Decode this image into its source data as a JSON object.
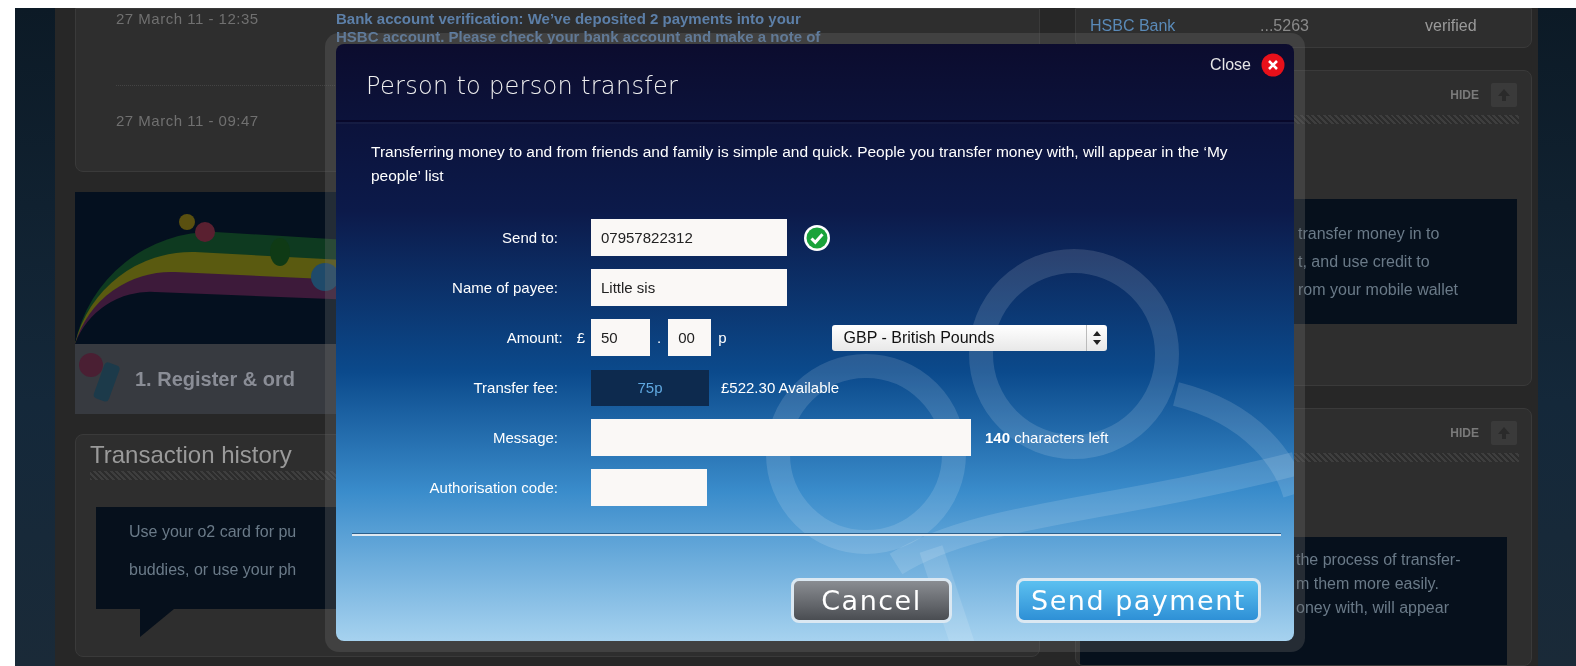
{
  "background": {
    "notifications": [
      {
        "time": "27 March 11 - 12:35",
        "lines": [
          "Bank account verification: We’ve deposited 2 payments into your",
          "HSBC account. Please check your bank account and make a note of"
        ]
      },
      {
        "time": "27 March 11 - 09:47"
      }
    ],
    "step": "1. Register & ord",
    "transaction_history": {
      "title": "Transaction history",
      "tip_lines": [
        "Use your o2 card for pu",
        "buddies, or use your ph"
      ]
    },
    "bank_account": {
      "name": "HSBC Bank",
      "number": "...5263",
      "status": "verified"
    },
    "side_panels": [
      {
        "hide": "HIDE",
        "tip_lines": [
          "transfer money in to",
          "t, and use credit to",
          "rom your mobile wallet"
        ]
      },
      {
        "hide": "HIDE",
        "tip_lines": [
          "the process of transfer-",
          "m them more easily.",
          "oney with, will appear"
        ]
      }
    ]
  },
  "dialog": {
    "title": "Person to person transfer",
    "close": "Close",
    "intro": "Transferring money to and from friends and family is simple and quick.  People you transfer money with, will appear in the ‘My people’ list",
    "fields": [
      {
        "kind": "text",
        "label": "Send to:",
        "value": "07957822312",
        "valid": true
      },
      {
        "kind": "text",
        "label": "Name of payee:",
        "value": "Little sis"
      },
      {
        "kind": "amount",
        "label": "Amount:",
        "currency_symbol": "£",
        "pounds": "50",
        "separator": ".",
        "pence": "00",
        "pence_unit": "p",
        "currency": "GBP - British Pounds"
      },
      {
        "kind": "fee",
        "label": "Transfer fee:",
        "value": "75p",
        "available": "£522.30 Available"
      },
      {
        "kind": "message",
        "label": "Message:",
        "counter": "**140** characters left"
      },
      {
        "kind": "code",
        "label": "Authorisation code:"
      }
    ],
    "buttons": [
      {
        "label": "Cancel",
        "kind": "secondary"
      },
      {
        "label": "Send payment",
        "kind": "primary"
      }
    ]
  }
}
